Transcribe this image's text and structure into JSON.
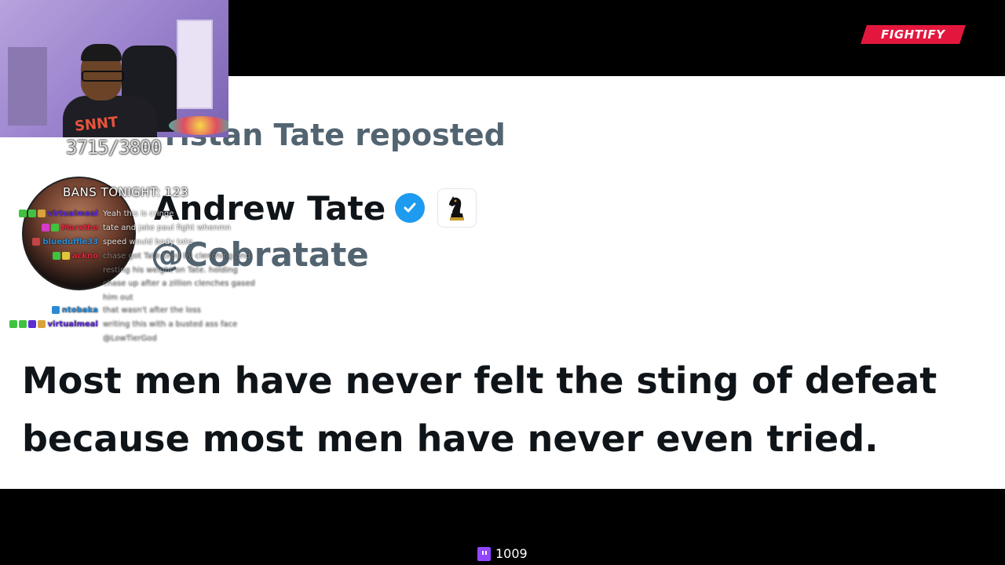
{
  "brand": {
    "logo": "FIGHTIFY",
    "accent": "#e3173e"
  },
  "stream": {
    "counter": "3715/3800",
    "bans": "BANS TONIGHT: 123",
    "viewer_count": "1009"
  },
  "post": {
    "repost_label": "ristan Tate reposted",
    "author_name": "Andrew Tate",
    "handle": "@Cobratate",
    "tweet_line_1": "Most men have never felt the sting of defeat",
    "tweet_line_2": "because most men have never even tried.",
    "verified_color": "#1d9bf0"
  },
  "chat": {
    "messages": [
      {
        "username": "virtualmeal",
        "color": "#5b2bd6",
        "text": "Yeah this is cringe",
        "badges": [
          "#3fc23f",
          "#3fc23f",
          "#d7a33a"
        ]
      },
      {
        "username": "Marxthe",
        "color": "#e0243c",
        "text": "tate and jake paul fight whenmn",
        "badges": [
          "#d63acb",
          "#3fc23f"
        ]
      },
      {
        "username": "blueduffle33",
        "color": "#2a8ad4",
        "text": "speed would body tate",
        "badges": [
          "#c24444"
        ]
      },
      {
        "username": "ackno",
        "color": "#e0243c",
        "text": "chase got Tate tired by clenching and resting his weight on Tate. holding chase up after a zillion clenches gased him out",
        "badges": [
          "#3fc23f",
          "#e0c53a"
        ]
      },
      {
        "username": "ntobaka",
        "color": "#2a8ad4",
        "text": "that wasn't after the loss",
        "badges": [
          "#2a8ad4"
        ]
      },
      {
        "username": "virtualmeal",
        "color": "#5b2bd6",
        "text": "writing this with a busted ass face @LowTierGod",
        "badges": [
          "#3fc23f",
          "#3fc23f",
          "#5b2bd6",
          "#d7a33a"
        ]
      }
    ]
  }
}
